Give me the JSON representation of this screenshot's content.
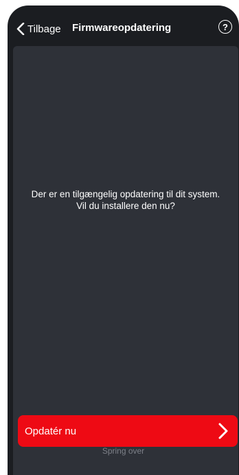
{
  "navbar": {
    "back_label": "Tilbage",
    "title": "Firmwareopdatering",
    "help_symbol": "?"
  },
  "message": {
    "line1": "Der er en tilgængelig opdatering til dit system.",
    "line2": "Vil du installere den nu?"
  },
  "actions": {
    "update_label": "Opdatér nu",
    "skip_label": "Spring over"
  },
  "icons": {
    "back": "chevron-left-icon",
    "help": "question-circle-icon",
    "update": "chevron-right-icon"
  },
  "colors": {
    "background": "#1b1d21",
    "panel": "#2e3138",
    "accent": "#ee0a14",
    "muted_text": "#7d8088"
  }
}
